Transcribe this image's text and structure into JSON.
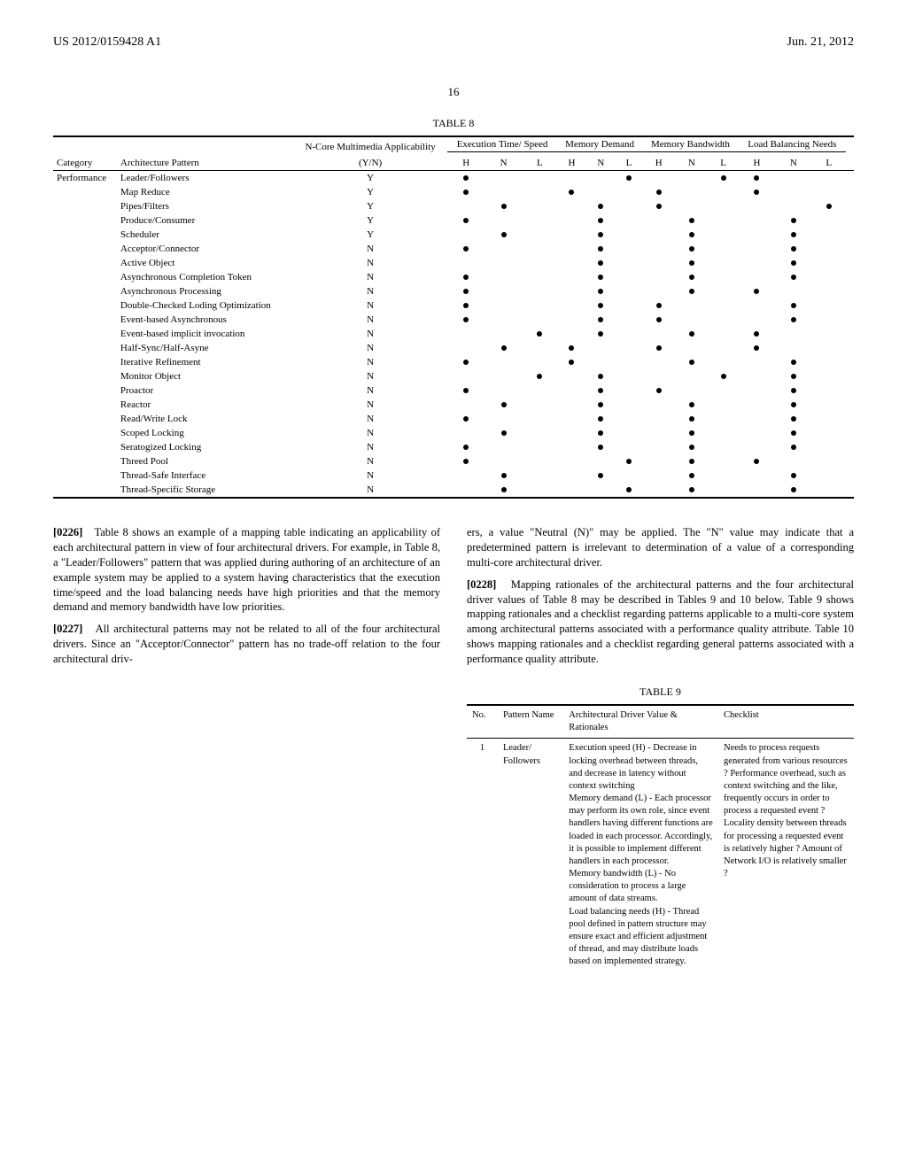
{
  "header": {
    "pub_number": "US 2012/0159428 A1",
    "pub_date": "Jun. 21, 2012",
    "page": "16"
  },
  "table8": {
    "caption": "TABLE 8",
    "group_headers": {
      "applicability": "N-Core Multimedia Applicability",
      "exec": "Execution Time/ Speed",
      "mem_demand": "Memory Demand",
      "mem_bw": "Memory Bandwidth",
      "load": "Load Balancing Needs"
    },
    "sub_headers": {
      "category": "Category",
      "pattern": "Architecture Pattern",
      "yn": "(Y/N)",
      "H": "H",
      "N": "N",
      "L": "L"
    },
    "category": "Performance",
    "rows": [
      {
        "name": "Leader/Followers",
        "yn": "Y",
        "exec": "H",
        "mem": "L",
        "bw": "L",
        "load": "H"
      },
      {
        "name": "Map Reduce",
        "yn": "Y",
        "exec": "H",
        "mem": "H",
        "bw": "H",
        "load": "H"
      },
      {
        "name": "Pipes/Filters",
        "yn": "Y",
        "exec": "N",
        "mem": "N",
        "bw": "H",
        "load": "L"
      },
      {
        "name": "Produce/Consumer",
        "yn": "Y",
        "exec": "H",
        "mem": "N",
        "bw": "N",
        "load": "N"
      },
      {
        "name": "Scheduler",
        "yn": "Y",
        "exec": "N",
        "mem": "N",
        "bw": "N",
        "load": "N"
      },
      {
        "name": "Acceptor/Connector",
        "yn": "N",
        "exec": "H",
        "mem": "N",
        "bw": "N",
        "load": "N"
      },
      {
        "name": "Active Object",
        "yn": "N",
        "exec": "",
        "mem": "N",
        "bw": "N",
        "load": "N"
      },
      {
        "name": "Asynchronous Completion Token",
        "yn": "N",
        "exec": "H",
        "mem": "N",
        "bw": "N",
        "load": "N"
      },
      {
        "name": "Asynchronous Processing",
        "yn": "N",
        "exec": "H",
        "mem": "N",
        "bw": "N",
        "load": "H"
      },
      {
        "name": "Double-Checked Loding Optimization",
        "yn": "N",
        "exec": "H",
        "mem": "N",
        "bw": "H",
        "load": "N"
      },
      {
        "name": "Event-based Asynchronous",
        "yn": "N",
        "exec": "H",
        "mem": "N",
        "bw": "H",
        "load": "N"
      },
      {
        "name": "Event-based implicit invocation",
        "yn": "N",
        "exec": "L",
        "mem": "N",
        "bw": "N",
        "load": "H"
      },
      {
        "name": "Half-Sync/Half-Asyne",
        "yn": "N",
        "exec": "N",
        "mem": "H",
        "bw": "H",
        "load": "H"
      },
      {
        "name": "Iterative Refinement",
        "yn": "N",
        "exec": "H",
        "mem": "H",
        "bw": "N",
        "load": "N"
      },
      {
        "name": "Monitor Object",
        "yn": "N",
        "exec": "L",
        "mem": "N",
        "bw": "L",
        "load": "N"
      },
      {
        "name": "Proactor",
        "yn": "N",
        "exec": "H",
        "mem": "N",
        "bw": "H",
        "load": "N"
      },
      {
        "name": "Reactor",
        "yn": "N",
        "exec": "N",
        "mem": "N",
        "bw": "N",
        "load": "N"
      },
      {
        "name": "Read/Write Lock",
        "yn": "N",
        "exec": "H",
        "mem": "N",
        "bw": "N",
        "load": "N"
      },
      {
        "name": "Scoped Locking",
        "yn": "N",
        "exec": "N",
        "mem": "N",
        "bw": "N",
        "load": "N"
      },
      {
        "name": "Seratogized Locking",
        "yn": "N",
        "exec": "H",
        "mem": "N",
        "bw": "N",
        "load": "N"
      },
      {
        "name": "Threed Pool",
        "yn": "N",
        "exec": "H",
        "mem": "L",
        "bw": "N",
        "load": "H"
      },
      {
        "name": "Thread-Safe Interface",
        "yn": "N",
        "exec": "N",
        "mem": "N",
        "bw": "N",
        "load": "N"
      },
      {
        "name": "Thread-Specific Storage",
        "yn": "N",
        "exec": "N",
        "mem": "L",
        "bw": "N",
        "load": "N"
      }
    ]
  },
  "paragraphs": {
    "p226_num": "[0226]",
    "p226": "Table 8 shows an example of a mapping table indicating an applicability of each architectural pattern in view of four architectural drivers. For example, in Table 8, a \"Leader/Followers\" pattern that was applied during authoring of an architecture of an example system may be applied to a system having characteristics that the execution time/speed and the load balancing needs have high priorities and that the memory demand and memory bandwidth have low priorities.",
    "p227_num": "[0227]",
    "p227": "All architectural patterns may not be related to all of the four architectural drivers. Since an \"Acceptor/Connector\" pattern has no trade-off relation to the four architectural driv-",
    "p227_cont": "ers, a value \"Neutral (N)\" may be applied. The \"N\" value may indicate that a predetermined pattern is irrelevant to determination of a value of a corresponding multi-core architectural driver.",
    "p228_num": "[0228]",
    "p228": "Mapping rationales of the architectural patterns and the four architectural driver values of Table 8 may be described in Tables 9 and 10 below. Table 9 shows mapping rationales and a checklist regarding patterns applicable to a multi-core system among architectural patterns associated with a performance quality attribute. Table 10 shows mapping rationales and a checklist regarding general patterns associated with a performance quality attribute."
  },
  "table9": {
    "caption": "TABLE 9",
    "headers": {
      "no": "No.",
      "name": "Pattern Name",
      "rationales": "Architectural Driver Value & Rationales",
      "checklist": "Checklist"
    },
    "row": {
      "no": "1",
      "name": "Leader/ Followers",
      "rationales": "Execution speed (H) - Decrease in locking overhead between threads, and decrease in latency without context switching\nMemory demand (L) - Each processor may perform its own role, since event handlers having different functions are loaded in each processor. Accordingly, it is possible to implement different handlers in each processor.\nMemory bandwidth (L) - No consideration to process a large amount of data streams.\nLoad balancing needs (H) - Thread pool defined in pattern structure may ensure exact and efficient adjustment of thread, and may distribute loads based on implemented strategy.",
      "checklist": "Needs to process requests generated from various resources ? Performance overhead, such as context switching and the like, frequently occurs in order to process a requested event ? Locality density between threads for processing a requested event is relatively higher ? Amount of Network I/O is relatively smaller ?"
    }
  }
}
